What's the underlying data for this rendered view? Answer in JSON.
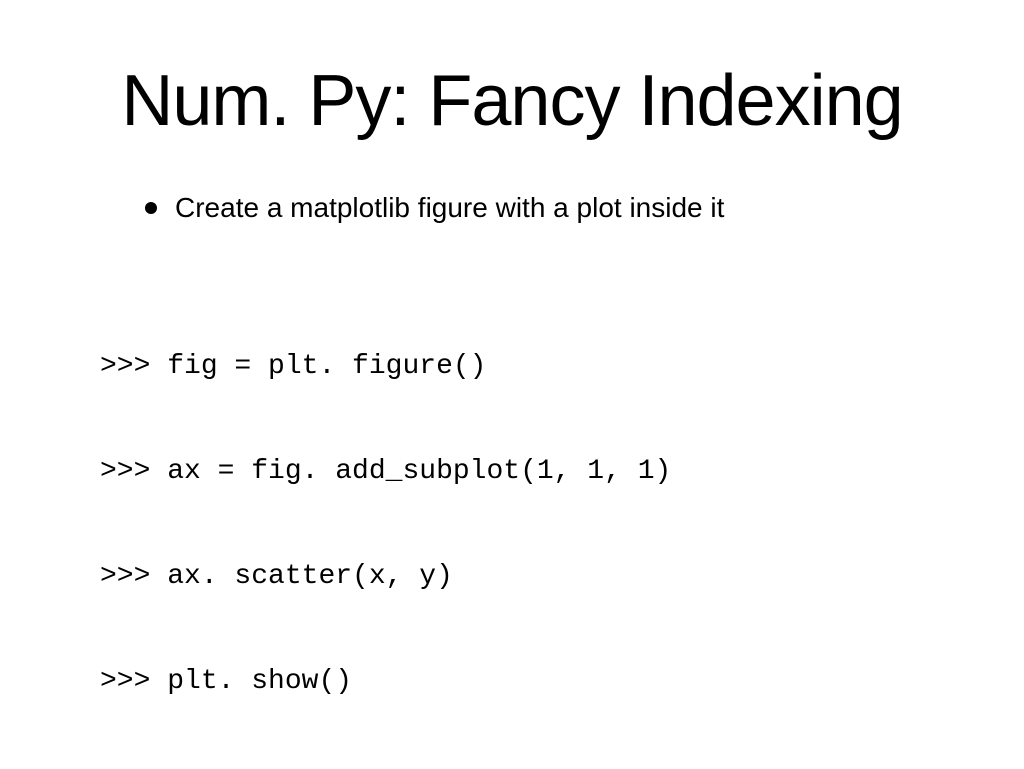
{
  "slide": {
    "title": "Num. Py: Fancy Indexing",
    "bullet": "Create a matplotlib figure with a plot inside it",
    "code_lines": [
      {
        "prompt": ">>> ",
        "code": "fig = plt. figure()"
      },
      {
        "prompt": ">>> ",
        "code": "ax = fig. add_subplot(1, 1, 1)"
      },
      {
        "prompt": ">>> ",
        "code": "ax. scatter(x, y)"
      },
      {
        "prompt": ">>> ",
        "code": "plt. show()"
      }
    ]
  }
}
